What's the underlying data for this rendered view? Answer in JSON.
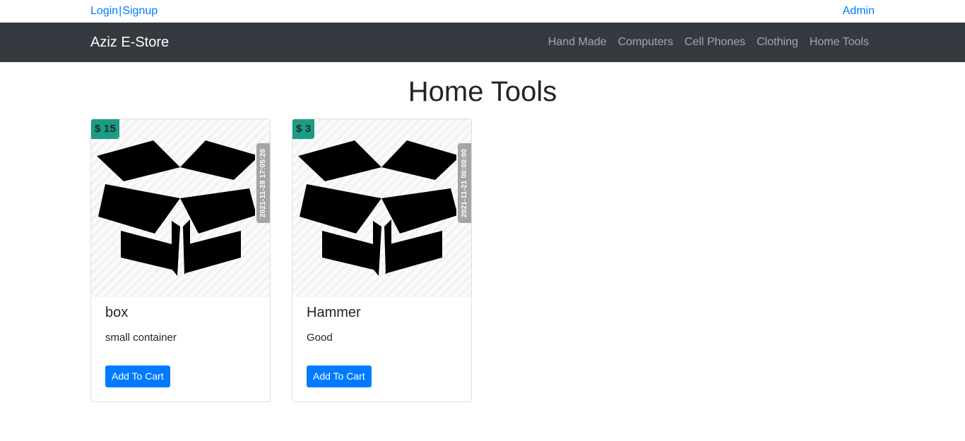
{
  "topbar": {
    "login": "Login",
    "separator": "|",
    "signup": "Signup",
    "admin": "Admin"
  },
  "navbar": {
    "brand": "Aziz E-Store",
    "links": [
      "Hand Made",
      "Computers",
      "Cell Phones",
      "Clothing",
      "Home Tools"
    ]
  },
  "page": {
    "title": "Home Tools"
  },
  "products": [
    {
      "price": "$ 15",
      "date": "2021-11-28 17:05:20",
      "name": "box",
      "description": "small container",
      "button": "Add To Cart",
      "image_icon": "open-box-icon"
    },
    {
      "price": "$ 3",
      "date": "2021-11-21 00:00:00",
      "name": "Hammer",
      "description": "Good",
      "button": "Add To Cart",
      "image_icon": "open-box-icon"
    }
  ],
  "colors": {
    "link": "#007bff",
    "navbar_bg": "#343a40",
    "price_badge": "#1c9c84",
    "date_badge": "#a5a5a5",
    "button": "#007bff"
  }
}
